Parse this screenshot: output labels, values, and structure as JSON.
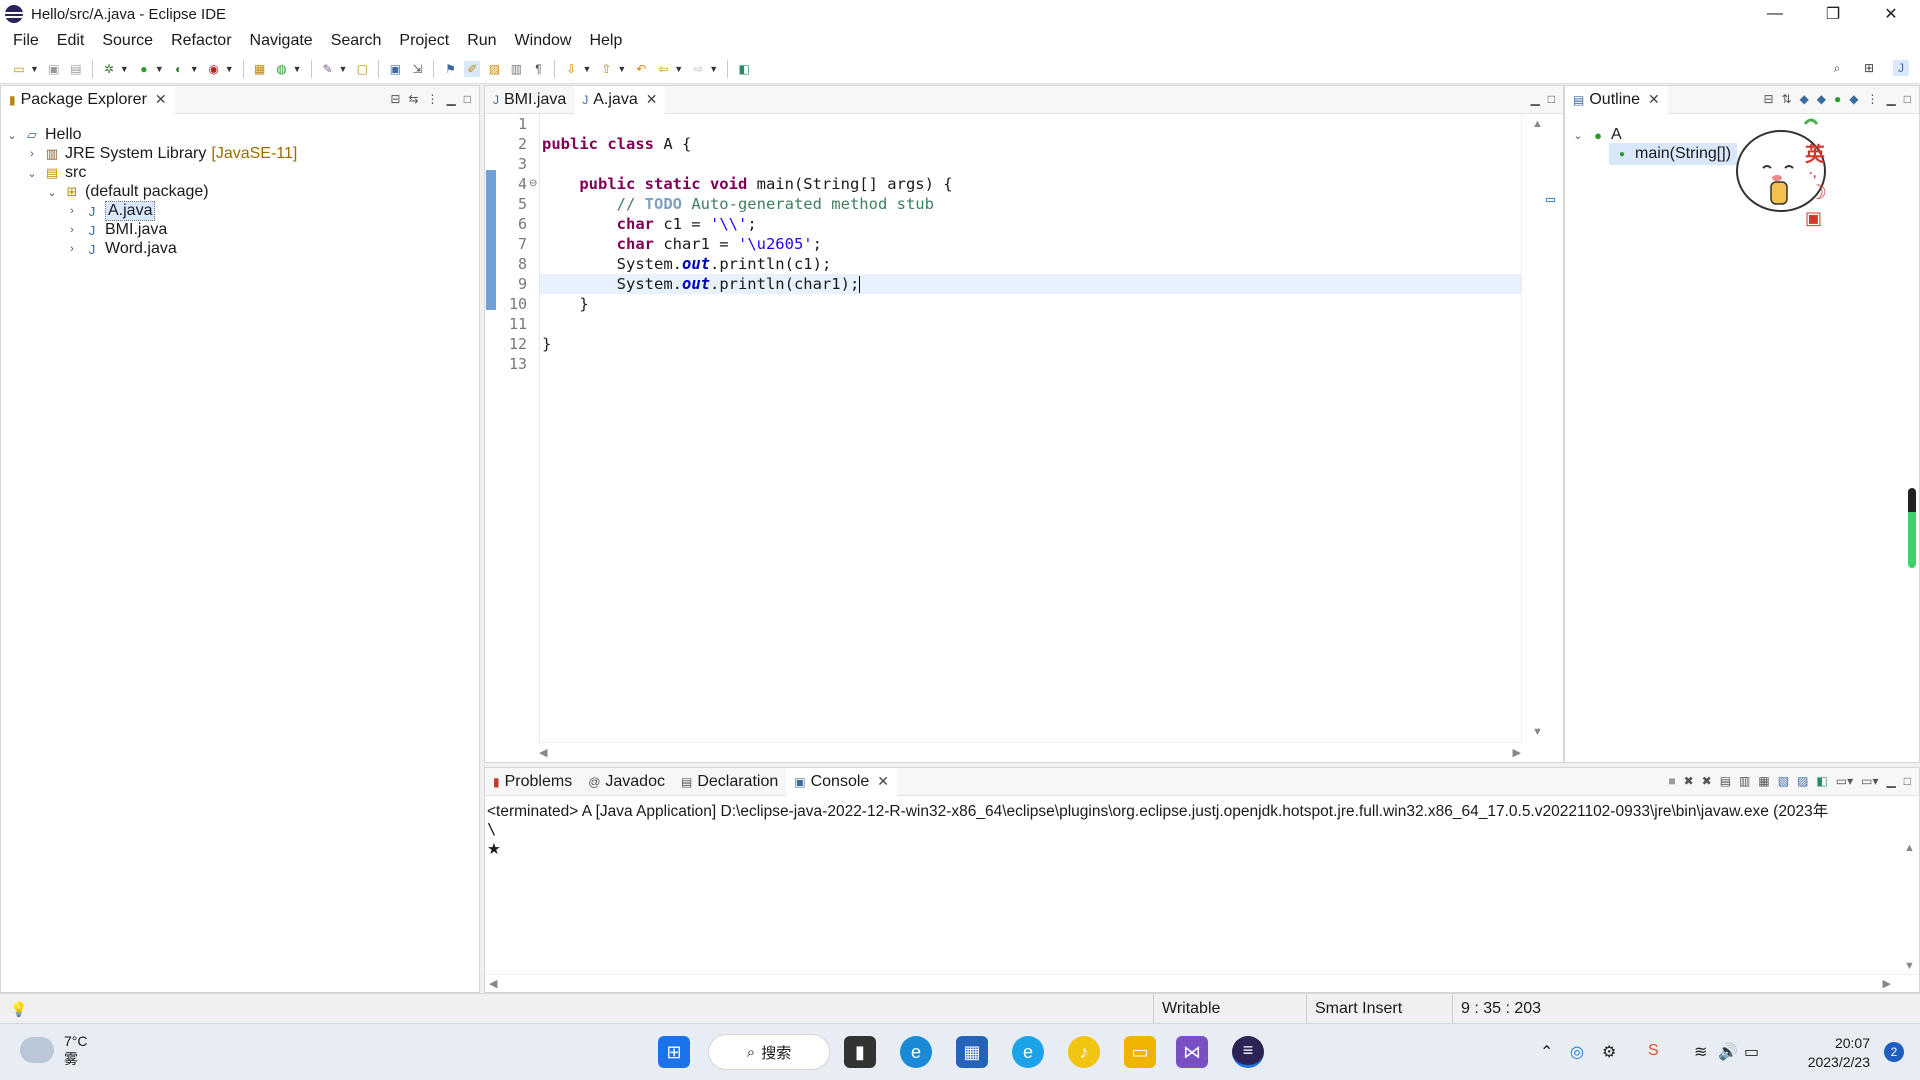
{
  "window": {
    "title": "Hello/src/A.java - Eclipse IDE",
    "minimize": "—",
    "maximize": "❐",
    "close": "✕"
  },
  "menu": [
    "File",
    "Edit",
    "Source",
    "Refactor",
    "Navigate",
    "Search",
    "Project",
    "Run",
    "Window",
    "Help"
  ],
  "package_explorer": {
    "tab": "Package Explorer",
    "tree": {
      "project": "Hello",
      "jre": "JRE System Library",
      "jre_version": "[JavaSE-11]",
      "src": "src",
      "package": "(default package)",
      "files": [
        "A.java",
        "BMI.java",
        "Word.java"
      ]
    }
  },
  "editor": {
    "tabs": [
      "BMI.java",
      "A.java"
    ],
    "line_numbers": [
      "1",
      "2",
      "3",
      "4",
      "5",
      "6",
      "7",
      "8",
      "9",
      "10",
      "11",
      "12",
      "13"
    ]
  },
  "outline": {
    "tab": "Outline",
    "class_name": "A",
    "method": "main(String[])",
    "ime_chars": [
      "英",
      "·,",
      "☽"
    ]
  },
  "console": {
    "tabs": [
      "Problems",
      "Javadoc",
      "Declaration",
      "Console"
    ],
    "header": "<terminated> A [Java Application] D:\\eclipse-java-2022-12-R-win32-x86_64\\eclipse\\plugins\\org.eclipse.justj.openjdk.hotspot.jre.full.win32.x86_64_17.0.5.v20221102-0933\\jre\\bin\\javaw.exe  (2023年",
    "output": [
      "\\",
      "★"
    ]
  },
  "status": {
    "writable": "Writable",
    "insert_mode": "Smart Insert",
    "position": "9 : 35 : 203"
  },
  "taskbar": {
    "temperature": "7°C",
    "weather": "雾",
    "search": "搜索",
    "time": "20:07",
    "date": "2023/2/23",
    "notifications": "2"
  },
  "colors": {
    "keyword": "#7f0055",
    "comment": "#3f7f5f",
    "string": "#2a00ff",
    "field": "#0000c0",
    "current_line": "#e8f2fe"
  }
}
